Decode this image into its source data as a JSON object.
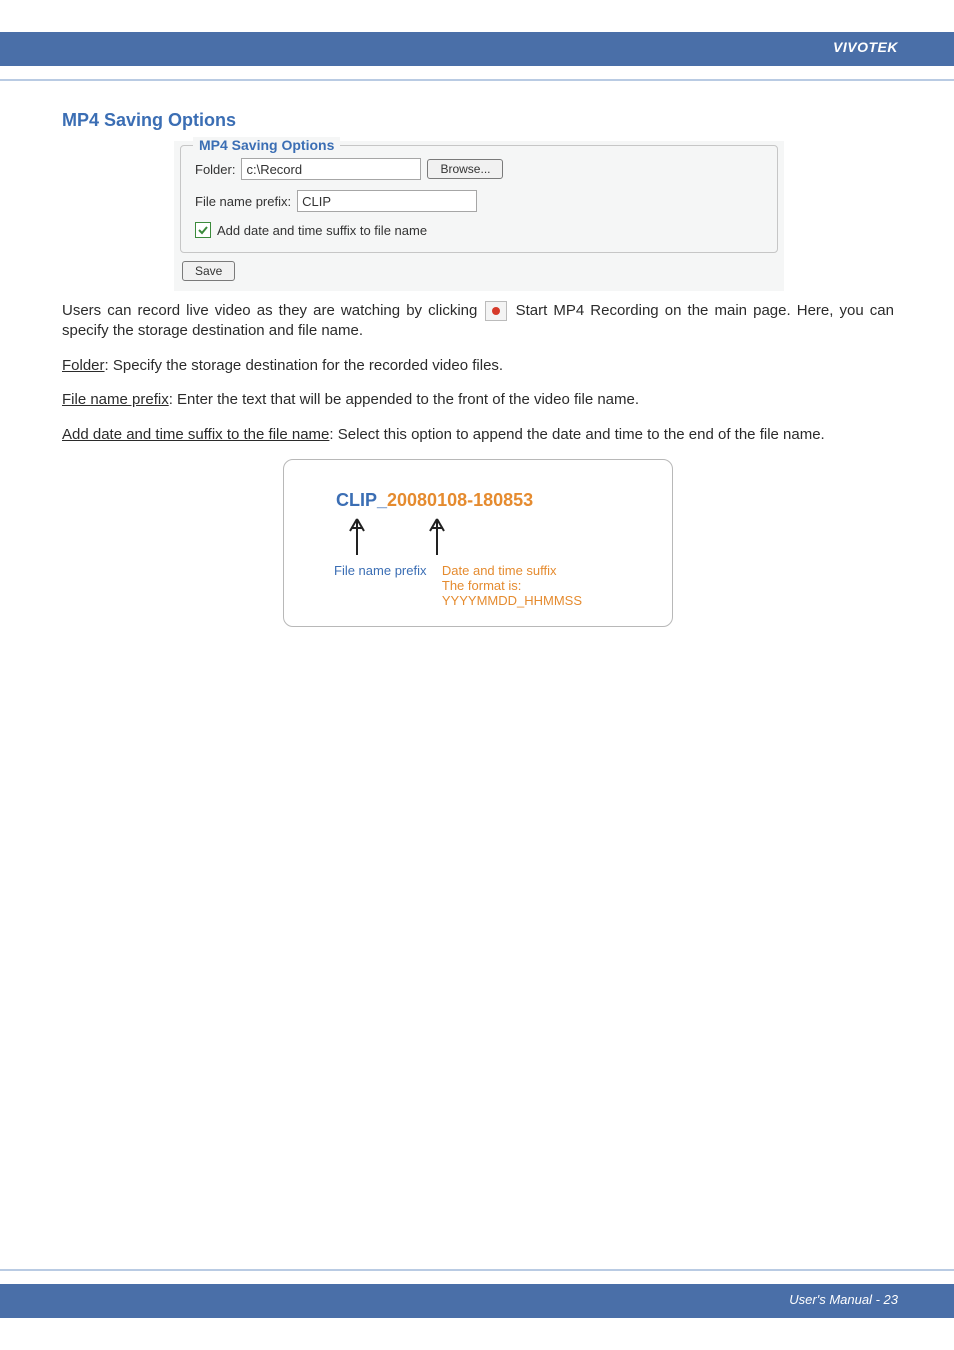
{
  "header": {
    "brand": "VIVOTEK"
  },
  "section_title": "MP4 Saving Options",
  "panel": {
    "legend": "MP4 Saving Options",
    "folder_label": "Folder:",
    "folder_value": "c:\\Record",
    "browse_label": "Browse...",
    "prefix_label": "File name prefix:",
    "prefix_value": "CLIP",
    "checkbox_label": "Add date and time suffix to file name",
    "checkbox_checked": true,
    "save_label": "Save"
  },
  "paragraphs": {
    "p1a": "Users can record live video as they are watching by clicking ",
    "p1b": " Start MP4 Recording on the main page. Here, you can specify the storage destination and file name.",
    "p2_u": "Folder",
    "p2_rest": ": Specify the storage destination for the recorded video files.",
    "p3_u": "File name prefix",
    "p3_rest": ": Enter the text that will be appended to the front of the video file name.",
    "p4_u": "Add date and time suffix to the file name",
    "p4_rest": ": Select this option to append the date and time to the end of the file name."
  },
  "illustration": {
    "prefix": "CLIP_",
    "date": "20080108-180853",
    "caption_prefix": "File name prefix",
    "caption_date_line1": "Date and time suffix",
    "caption_date_line2": "The format is: YYYYMMDD_HHMMSS"
  },
  "footer": {
    "text": "User's Manual - 23"
  }
}
